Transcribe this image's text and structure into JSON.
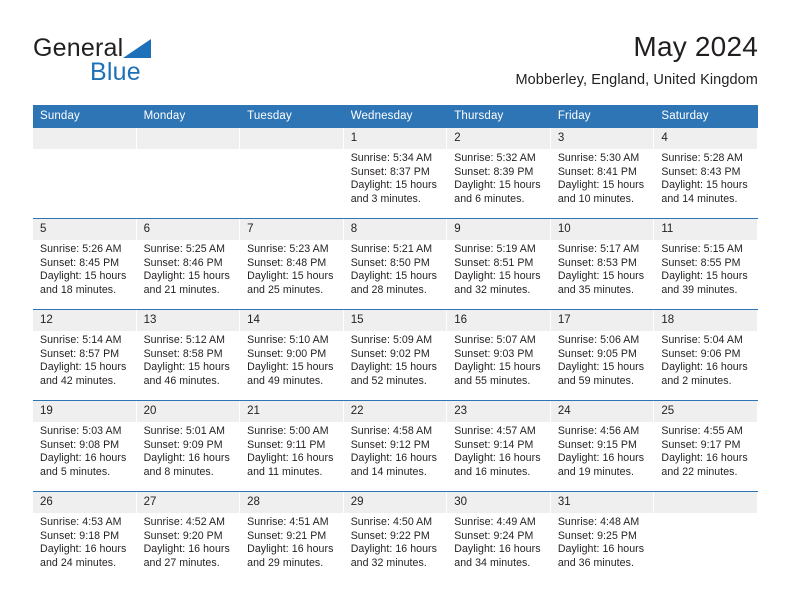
{
  "logo": {
    "word_one": "General",
    "word_two": "Blue",
    "triangle_color": "#1d71b8",
    "word_two_color": "#1d71b8"
  },
  "header": {
    "title": "May 2024",
    "subtitle": "Mobberley, England, United Kingdom"
  },
  "colors": {
    "header_row_background": "#2e75b6",
    "header_row_text": "#ffffff",
    "daynumber_strip_background": "#efefef",
    "week_divider": "#2e75b6",
    "body_text": "#231f20",
    "page_background": "#ffffff"
  },
  "calendar": {
    "weekday_headers": [
      "Sunday",
      "Monday",
      "Tuesday",
      "Wednesday",
      "Thursday",
      "Friday",
      "Saturday"
    ],
    "weeks": [
      [
        {
          "day": "",
          "empty": true,
          "sunrise": "",
          "sunset": "",
          "daylight_line1": "",
          "daylight_line2": ""
        },
        {
          "day": "",
          "empty": true,
          "sunrise": "",
          "sunset": "",
          "daylight_line1": "",
          "daylight_line2": ""
        },
        {
          "day": "",
          "empty": true,
          "sunrise": "",
          "sunset": "",
          "daylight_line1": "",
          "daylight_line2": ""
        },
        {
          "day": "1",
          "empty": false,
          "sunrise": "Sunrise: 5:34 AM",
          "sunset": "Sunset: 8:37 PM",
          "daylight_line1": "Daylight: 15 hours",
          "daylight_line2": "and 3 minutes."
        },
        {
          "day": "2",
          "empty": false,
          "sunrise": "Sunrise: 5:32 AM",
          "sunset": "Sunset: 8:39 PM",
          "daylight_line1": "Daylight: 15 hours",
          "daylight_line2": "and 6 minutes."
        },
        {
          "day": "3",
          "empty": false,
          "sunrise": "Sunrise: 5:30 AM",
          "sunset": "Sunset: 8:41 PM",
          "daylight_line1": "Daylight: 15 hours",
          "daylight_line2": "and 10 minutes."
        },
        {
          "day": "4",
          "empty": false,
          "sunrise": "Sunrise: 5:28 AM",
          "sunset": "Sunset: 8:43 PM",
          "daylight_line1": "Daylight: 15 hours",
          "daylight_line2": "and 14 minutes."
        }
      ],
      [
        {
          "day": "5",
          "empty": false,
          "sunrise": "Sunrise: 5:26 AM",
          "sunset": "Sunset: 8:45 PM",
          "daylight_line1": "Daylight: 15 hours",
          "daylight_line2": "and 18 minutes."
        },
        {
          "day": "6",
          "empty": false,
          "sunrise": "Sunrise: 5:25 AM",
          "sunset": "Sunset: 8:46 PM",
          "daylight_line1": "Daylight: 15 hours",
          "daylight_line2": "and 21 minutes."
        },
        {
          "day": "7",
          "empty": false,
          "sunrise": "Sunrise: 5:23 AM",
          "sunset": "Sunset: 8:48 PM",
          "daylight_line1": "Daylight: 15 hours",
          "daylight_line2": "and 25 minutes."
        },
        {
          "day": "8",
          "empty": false,
          "sunrise": "Sunrise: 5:21 AM",
          "sunset": "Sunset: 8:50 PM",
          "daylight_line1": "Daylight: 15 hours",
          "daylight_line2": "and 28 minutes."
        },
        {
          "day": "9",
          "empty": false,
          "sunrise": "Sunrise: 5:19 AM",
          "sunset": "Sunset: 8:51 PM",
          "daylight_line1": "Daylight: 15 hours",
          "daylight_line2": "and 32 minutes."
        },
        {
          "day": "10",
          "empty": false,
          "sunrise": "Sunrise: 5:17 AM",
          "sunset": "Sunset: 8:53 PM",
          "daylight_line1": "Daylight: 15 hours",
          "daylight_line2": "and 35 minutes."
        },
        {
          "day": "11",
          "empty": false,
          "sunrise": "Sunrise: 5:15 AM",
          "sunset": "Sunset: 8:55 PM",
          "daylight_line1": "Daylight: 15 hours",
          "daylight_line2": "and 39 minutes."
        }
      ],
      [
        {
          "day": "12",
          "empty": false,
          "sunrise": "Sunrise: 5:14 AM",
          "sunset": "Sunset: 8:57 PM",
          "daylight_line1": "Daylight: 15 hours",
          "daylight_line2": "and 42 minutes."
        },
        {
          "day": "13",
          "empty": false,
          "sunrise": "Sunrise: 5:12 AM",
          "sunset": "Sunset: 8:58 PM",
          "daylight_line1": "Daylight: 15 hours",
          "daylight_line2": "and 46 minutes."
        },
        {
          "day": "14",
          "empty": false,
          "sunrise": "Sunrise: 5:10 AM",
          "sunset": "Sunset: 9:00 PM",
          "daylight_line1": "Daylight: 15 hours",
          "daylight_line2": "and 49 minutes."
        },
        {
          "day": "15",
          "empty": false,
          "sunrise": "Sunrise: 5:09 AM",
          "sunset": "Sunset: 9:02 PM",
          "daylight_line1": "Daylight: 15 hours",
          "daylight_line2": "and 52 minutes."
        },
        {
          "day": "16",
          "empty": false,
          "sunrise": "Sunrise: 5:07 AM",
          "sunset": "Sunset: 9:03 PM",
          "daylight_line1": "Daylight: 15 hours",
          "daylight_line2": "and 55 minutes."
        },
        {
          "day": "17",
          "empty": false,
          "sunrise": "Sunrise: 5:06 AM",
          "sunset": "Sunset: 9:05 PM",
          "daylight_line1": "Daylight: 15 hours",
          "daylight_line2": "and 59 minutes."
        },
        {
          "day": "18",
          "empty": false,
          "sunrise": "Sunrise: 5:04 AM",
          "sunset": "Sunset: 9:06 PM",
          "daylight_line1": "Daylight: 16 hours",
          "daylight_line2": "and 2 minutes."
        }
      ],
      [
        {
          "day": "19",
          "empty": false,
          "sunrise": "Sunrise: 5:03 AM",
          "sunset": "Sunset: 9:08 PM",
          "daylight_line1": "Daylight: 16 hours",
          "daylight_line2": "and 5 minutes."
        },
        {
          "day": "20",
          "empty": false,
          "sunrise": "Sunrise: 5:01 AM",
          "sunset": "Sunset: 9:09 PM",
          "daylight_line1": "Daylight: 16 hours",
          "daylight_line2": "and 8 minutes."
        },
        {
          "day": "21",
          "empty": false,
          "sunrise": "Sunrise: 5:00 AM",
          "sunset": "Sunset: 9:11 PM",
          "daylight_line1": "Daylight: 16 hours",
          "daylight_line2": "and 11 minutes."
        },
        {
          "day": "22",
          "empty": false,
          "sunrise": "Sunrise: 4:58 AM",
          "sunset": "Sunset: 9:12 PM",
          "daylight_line1": "Daylight: 16 hours",
          "daylight_line2": "and 14 minutes."
        },
        {
          "day": "23",
          "empty": false,
          "sunrise": "Sunrise: 4:57 AM",
          "sunset": "Sunset: 9:14 PM",
          "daylight_line1": "Daylight: 16 hours",
          "daylight_line2": "and 16 minutes."
        },
        {
          "day": "24",
          "empty": false,
          "sunrise": "Sunrise: 4:56 AM",
          "sunset": "Sunset: 9:15 PM",
          "daylight_line1": "Daylight: 16 hours",
          "daylight_line2": "and 19 minutes."
        },
        {
          "day": "25",
          "empty": false,
          "sunrise": "Sunrise: 4:55 AM",
          "sunset": "Sunset: 9:17 PM",
          "daylight_line1": "Daylight: 16 hours",
          "daylight_line2": "and 22 minutes."
        }
      ],
      [
        {
          "day": "26",
          "empty": false,
          "sunrise": "Sunrise: 4:53 AM",
          "sunset": "Sunset: 9:18 PM",
          "daylight_line1": "Daylight: 16 hours",
          "daylight_line2": "and 24 minutes."
        },
        {
          "day": "27",
          "empty": false,
          "sunrise": "Sunrise: 4:52 AM",
          "sunset": "Sunset: 9:20 PM",
          "daylight_line1": "Daylight: 16 hours",
          "daylight_line2": "and 27 minutes."
        },
        {
          "day": "28",
          "empty": false,
          "sunrise": "Sunrise: 4:51 AM",
          "sunset": "Sunset: 9:21 PM",
          "daylight_line1": "Daylight: 16 hours",
          "daylight_line2": "and 29 minutes."
        },
        {
          "day": "29",
          "empty": false,
          "sunrise": "Sunrise: 4:50 AM",
          "sunset": "Sunset: 9:22 PM",
          "daylight_line1": "Daylight: 16 hours",
          "daylight_line2": "and 32 minutes."
        },
        {
          "day": "30",
          "empty": false,
          "sunrise": "Sunrise: 4:49 AM",
          "sunset": "Sunset: 9:24 PM",
          "daylight_line1": "Daylight: 16 hours",
          "daylight_line2": "and 34 minutes."
        },
        {
          "day": "31",
          "empty": false,
          "sunrise": "Sunrise: 4:48 AM",
          "sunset": "Sunset: 9:25 PM",
          "daylight_line1": "Daylight: 16 hours",
          "daylight_line2": "and 36 minutes."
        },
        {
          "day": "",
          "empty": true,
          "sunrise": "",
          "sunset": "",
          "daylight_line1": "",
          "daylight_line2": ""
        }
      ]
    ]
  }
}
